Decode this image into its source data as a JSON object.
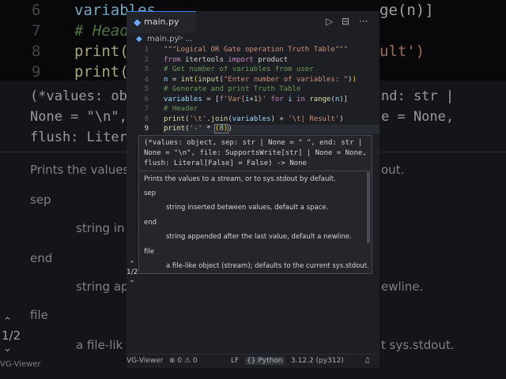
{
  "background": {
    "line_numbers": [
      "6",
      "7",
      "8",
      "9"
    ],
    "code_lines": [
      "variables",
      "# Heade",
      "print('",
      "print('"
    ],
    "code_tail": [
      "ge(n)]",
      "",
      "ult')",
      ""
    ],
    "signature_lines": [
      "(*values: ob",
      "None = \"\\n\",",
      "flush: Liter"
    ],
    "signature_tails": [
      "nd: str |",
      "e = None,",
      ""
    ],
    "doc_texts": [
      "Prints the values",
      "sep",
      "string in",
      "end",
      "string ap",
      "file",
      "a file-lik"
    ],
    "doc_tails": [
      "out.",
      "",
      "",
      "",
      "ewline.",
      "",
      "t sys.stdout."
    ],
    "pager_fraction": "1/2",
    "status_left": "VG-Viewer"
  },
  "tab": {
    "icon": "python-file-icon",
    "label": "main.py"
  },
  "toolbar": {
    "run": "▷",
    "split": "⊟",
    "more": "···"
  },
  "breadcrumb": {
    "file": "main.py",
    "separator": ">",
    "more": "..."
  },
  "editor": {
    "active_line": 9,
    "line_numbers": [
      "1",
      "2",
      "3",
      "4",
      "5",
      "6",
      "7",
      "8",
      "9"
    ]
  },
  "hover": {
    "signature": "(*values: object, sep: str | None = \" \", end: str |\nNone = \"\\n\", file: SupportsWrite[str] | None = None,\nflush: Literal[False] = False) -> None",
    "summary": "Prints the values to a stream, or to sys.stdout by default.",
    "params": [
      {
        "name": "sep",
        "desc": "string inserted between values, default a space."
      },
      {
        "name": "end",
        "desc": "string appended after the last value, default a newline."
      },
      {
        "name": "file",
        "desc": "a file-like object (stream); defaults to the current sys.stdout."
      }
    ],
    "pager": "1/2"
  },
  "statusbar": {
    "left": "VG-Viewer",
    "problems": "⊗ 0 ⚠ 0",
    "eol": "LF",
    "language": "{} Python",
    "interpreter": "3.12.2 (py312)",
    "bell": "🔔"
  }
}
